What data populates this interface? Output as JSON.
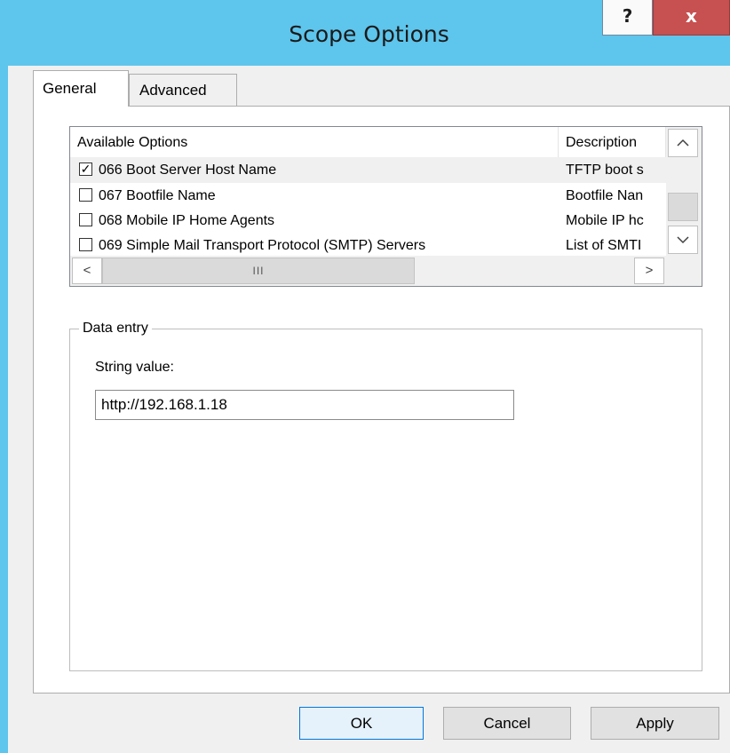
{
  "window": {
    "title": "Scope Options",
    "help_label": "?",
    "close_label": "x"
  },
  "tabs": [
    {
      "label": "General",
      "active": true
    },
    {
      "label": "Advanced",
      "active": false
    }
  ],
  "options_list": {
    "columns": {
      "name": "Available Options",
      "description": "Description"
    },
    "rows": [
      {
        "checked": true,
        "name": "066 Boot Server Host Name",
        "description": "TFTP boot s"
      },
      {
        "checked": false,
        "name": "067 Bootfile Name",
        "description": "Bootfile Nan"
      },
      {
        "checked": false,
        "name": "068 Mobile IP Home Agents",
        "description": "Mobile IP hc"
      },
      {
        "checked": false,
        "name": "069 Simple Mail Transport Protocol (SMTP) Servers",
        "description": "List of SMTI"
      }
    ],
    "scroll_up_glyph": "^",
    "scroll_down_glyph": "v",
    "scroll_left_glyph": "<",
    "scroll_right_glyph": ">",
    "hscroll_grip": "III"
  },
  "data_entry": {
    "legend": "Data entry",
    "string_label": "String value:",
    "string_value": "http://192.168.1.18"
  },
  "buttons": {
    "ok": "OK",
    "cancel": "Cancel",
    "apply": "Apply"
  },
  "colors": {
    "titlebar": "#5ec5ec",
    "close": "#c75050",
    "panel": "#ffffff",
    "dialog": "#f0f0f0"
  }
}
